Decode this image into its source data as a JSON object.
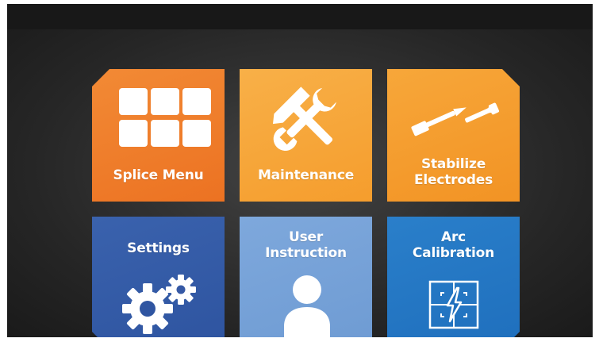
{
  "screen": {
    "tiles": {
      "splice_menu": {
        "label": "Splice Menu",
        "icon": "grid-icon",
        "color": "#ec7222"
      },
      "maintenance": {
        "label": "Maintenance",
        "icon": "tools-icon",
        "color": "#f59d2d"
      },
      "stabilize_electrodes": {
        "label_line1": "Stabilize",
        "label_line2": "Electrodes",
        "icon": "electrodes-icon",
        "color": "#f29324"
      },
      "settings": {
        "label": "Settings",
        "icon": "gears-icon",
        "color": "#2e54a0"
      },
      "user_instruction": {
        "label_line1": "User",
        "label_line2": "Instruction",
        "icon": "user-icon",
        "color": "#6e9bd3"
      },
      "arc_calibration": {
        "label_line1": "Arc",
        "label_line2": "Calibration",
        "icon": "arc-calibration-icon",
        "color": "#1f6fbd"
      }
    }
  }
}
